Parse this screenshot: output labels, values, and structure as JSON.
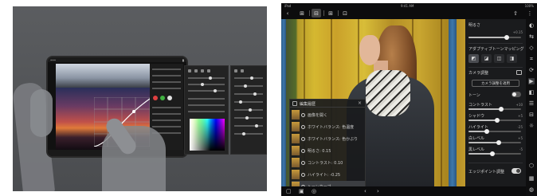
{
  "left_panel": {
    "tablet_status": {
      "left": "•••",
      "right": "▮"
    },
    "icons": [
      "hand-left",
      "hand-right",
      "finger"
    ]
  },
  "app": {
    "status": {
      "carrier": "iPad",
      "time": "9:41 AM",
      "battery": "100%"
    },
    "toolbar": {
      "back": "‹",
      "buttons": [
        "⊞",
        "⊟",
        "⊞",
        "⊡",
        "⊠"
      ],
      "right_icons": [
        "⇧",
        "⋮"
      ]
    },
    "overlay": {
      "title": "編集履歴",
      "close": "×",
      "items": [
        {
          "label": "画像を開く",
          "selected": false
        },
        {
          "label": "ホワイトバランス: 色温度",
          "selected": false
        },
        {
          "label": "ホワイトバランス: 色かぶり",
          "selected": false
        },
        {
          "label": "明るさ: 0.15",
          "selected": false
        },
        {
          "label": "コントラスト: 0.10",
          "selected": false
        },
        {
          "label": "ハイライト: -0.25",
          "selected": false
        },
        {
          "label": "トーンカーブ",
          "selected": true
        }
      ]
    },
    "side_panel": {
      "brightness_label": "明るさ",
      "brightness_value": "+0.15",
      "brightness_level": 0.72,
      "adaptive_label": "アダプティブトーンマッピング",
      "tool_icons": [
        "◩",
        "◪",
        "◫",
        "◨"
      ],
      "camera_section_label": "カメラ調整",
      "camera_button": "カメラ調整を適用",
      "rows": [
        {
          "label": "トーン",
          "value": "",
          "toggle": true
        },
        {
          "label": "コントラスト",
          "value": "+10",
          "level": 0.62
        },
        {
          "label": "シャドウ",
          "value": "+5",
          "level": 0.55
        },
        {
          "label": "ハイライト",
          "value": "-25",
          "level": 0.35
        },
        {
          "label": "白レベル",
          "value": "+5",
          "level": 0.58
        },
        {
          "label": "黒レベル",
          "value": "-5",
          "level": 0.45
        }
      ],
      "bottom_toggle_label": "エッジポイント調整"
    },
    "rail_icons": [
      "◐",
      "⇆",
      "◇",
      "⌗",
      "⟳",
      "▶",
      "◧",
      "☰",
      "⊟",
      "☼",
      "⬡",
      "▦",
      "◍"
    ],
    "bottom_icons": [
      "▢",
      "▣",
      "◎",
      "‹",
      "›"
    ]
  }
}
